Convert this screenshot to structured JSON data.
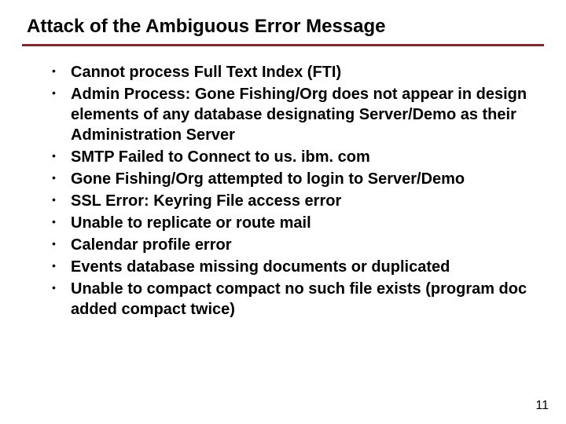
{
  "title": "Attack of the Ambiguous Error Message",
  "bullets": [
    "Cannot process Full Text Index (FTI)",
    " Admin Process: Gone Fishing/Org does not appear in design  elements of any database designating Server/Demo as their Administration Server",
    " SMTP Failed to Connect to us. ibm. com",
    " Gone Fishing/Org attempted to login to Server/Demo",
    " SSL Error: Keyring File access error",
    " Unable to replicate or route mail",
    " Calendar profile error",
    " Events database missing documents or duplicated",
    " Unable to compact compact no such file exists (program doc added compact twice)"
  ],
  "page_number": "11"
}
